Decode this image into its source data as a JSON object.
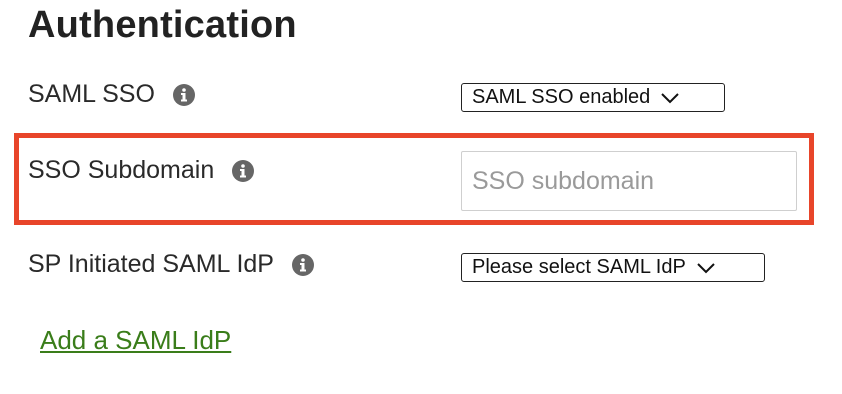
{
  "section": {
    "title": "Authentication"
  },
  "rows": {
    "saml_sso": {
      "label": "SAML SSO",
      "select_value": "SAML SSO enabled"
    },
    "sso_subdomain": {
      "label": "SSO Subdomain",
      "input_value": "",
      "input_placeholder": "SSO subdomain"
    },
    "sp_initiated": {
      "label": "SP Initiated SAML IdP",
      "select_value": "Please select SAML IdP"
    }
  },
  "links": {
    "add_idp": "Add a SAML IdP"
  },
  "icons": {
    "info": "info-icon",
    "chevron": "chevron-down-icon"
  },
  "colors": {
    "highlight": "#e8452a",
    "link": "#3a7d1a",
    "info_icon": "#666666"
  }
}
